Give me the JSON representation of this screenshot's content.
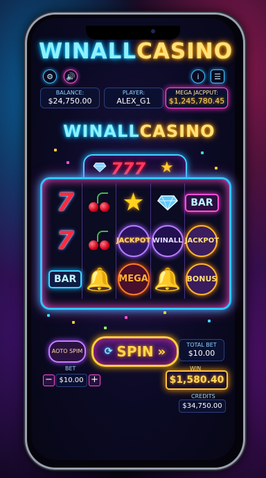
{
  "header": {
    "logo_part1": "WINALL",
    "logo_part2": "CASINO"
  },
  "hud": {
    "balance_label": "BALANCE:",
    "balance_value": "$24,750.00",
    "player_label": "PLAYER:",
    "player_value": "ALEX_G1",
    "jackpot_label": "MEGA JACPPUT:",
    "jackpot_value": "$1,245,780.45"
  },
  "marquee": {
    "logo_part1": "WINALL",
    "logo_part2": "CASINO",
    "sevens": "777"
  },
  "reels": [
    [
      "7",
      "7",
      "BAR"
    ],
    [
      "cherry",
      "cherry",
      "bell"
    ],
    [
      "star",
      "JACKPOT",
      "MEGA"
    ],
    [
      "diamond",
      "WINALL",
      "bell"
    ],
    [
      "BAR",
      "JACKPOT",
      "BONUS"
    ]
  ],
  "reel_text": {
    "seven": "7",
    "bar": "BAR",
    "jackpot": "JACKPOT",
    "winall": "WINALL",
    "mega": "MEGA",
    "bonus": "BONUS",
    "star": "★",
    "bell": "🔔"
  },
  "controls": {
    "autospin_label": "AOTO SPIM",
    "spin_label": "SPIN",
    "total_bet_label": "TOTAL BET",
    "total_bet_value": "$10.00",
    "bet_label": "BET",
    "bet_value": "$10.00",
    "bet_minus": "−",
    "bet_plus": "+",
    "win_label": "WIN",
    "win_value": "$1,580.40",
    "credits_label": "CREDITS",
    "credits_value": "$34,750.00"
  },
  "icons": [
    "settings-icon",
    "sound-icon",
    "info-icon",
    "paytable-icon",
    "refresh-icon",
    "fast-forward-icon"
  ],
  "colors": {
    "neon_blue": "#2fc6ff",
    "neon_pink": "#ff4fd8",
    "gold": "#ffcf3a",
    "red": "#ff2a3f"
  }
}
